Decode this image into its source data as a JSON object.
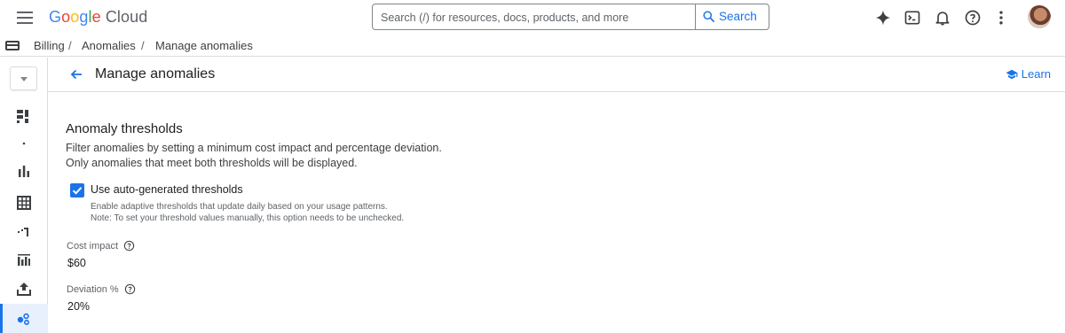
{
  "header": {
    "logo_google": [
      "G",
      "o",
      "o",
      "g",
      "l",
      "e"
    ],
    "logo_cloud": "Cloud",
    "search_placeholder": "Search (/) for resources, docs, products, and more",
    "search_button": "Search",
    "icons": [
      "gemini-sparkle-icon",
      "cloud-shell-icon",
      "notifications-icon",
      "help-icon",
      "more-vert-icon",
      "avatar"
    ]
  },
  "breadcrumb": {
    "items": [
      "Billing",
      "Anomalies",
      "Manage anomalies"
    ],
    "separator": "/"
  },
  "rail": {
    "icons": [
      "overview-icon",
      "dot-icon",
      "reports-icon",
      "table-icon",
      "trend-icon",
      "chart-icon",
      "export-icon",
      "anomalies-icon"
    ],
    "active": "anomalies-icon"
  },
  "page": {
    "title": "Manage anomalies",
    "learn": "Learn"
  },
  "thresholds": {
    "title": "Anomaly thresholds",
    "description": "Filter anomalies by setting a minimum cost impact and percentage deviation. Only anomalies that meet both thresholds will be displayed.",
    "auto_label": "Use auto-generated thresholds",
    "auto_checked": true,
    "auto_help_1": "Enable adaptive thresholds that update daily based on your usage patterns.",
    "auto_help_2": "Note: To set your threshold values manually, this option needs to be unchecked.",
    "cost_label": "Cost impact",
    "cost_value": "$60",
    "deviation_label": "Deviation %",
    "deviation_value": "20%"
  },
  "colors": {
    "accent": "#1a73e8",
    "border": "#dadce0",
    "text": "#202124",
    "secondary": "#5f6368"
  }
}
